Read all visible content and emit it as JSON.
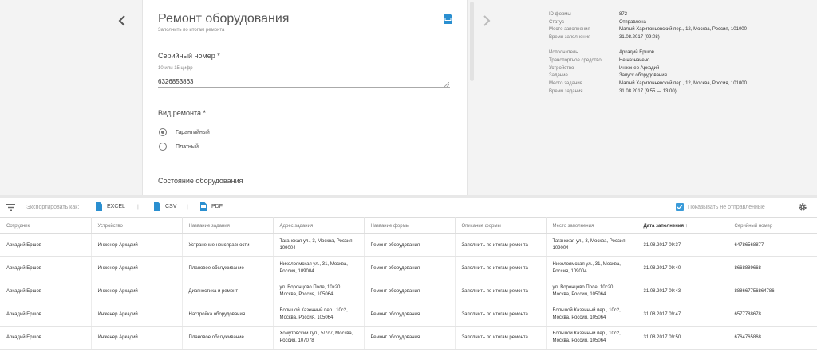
{
  "form": {
    "title": "Ремонт оборудования",
    "subtitle": "Заполнить по итогам ремонта",
    "serial_label": "Серийный номер *",
    "serial_hint": "10 или 15 цифр",
    "serial_value": "6326853863",
    "repair_label": "Вид ремонта *",
    "repair_options": [
      {
        "label": "Гарантийный",
        "checked": true
      },
      {
        "label": "Платный",
        "checked": false
      }
    ],
    "state_label": "Состояние оборудования"
  },
  "info": [
    {
      "key": "ID формы",
      "value": "872"
    },
    {
      "key": "Статус",
      "value": "Отправлена"
    },
    {
      "key": "Место заполнения",
      "value": "Малый Харитоньевский пер., 12, Москва, Россия, 101000"
    },
    {
      "key": "Время заполнения",
      "value": "31.08.2017 (09:08)"
    },
    {
      "key": "Исполнитель",
      "value": "Аркадий Ершов"
    },
    {
      "key": "Транспортное средство",
      "value": "Не назначено"
    },
    {
      "key": "Устройство",
      "value": "Инженер Аркадий"
    },
    {
      "key": "Задание",
      "value": "Запуск оборудования"
    },
    {
      "key": "Место задания",
      "value": "Малый Харитоньевский пер., 12, Москва, Россия, 101000"
    },
    {
      "key": "Время задания",
      "value": "31.08.2017 (9:55 — 13:00)"
    }
  ],
  "toolbar": {
    "export_label": "Экспортировать как:",
    "excel": "EXCEL",
    "csv": "CSV",
    "pdf": "PDF",
    "sep": "|",
    "show_unsent": "Показывать не отправленные"
  },
  "table": {
    "columns": [
      "Сотрудник",
      "Устройство",
      "Название задания",
      "Адрес задания",
      "Название формы",
      "Описание формы",
      "Место заполнения",
      "Дата заполнения ↑",
      "Серийный номер"
    ],
    "rows": [
      [
        "Аркадий Ершов",
        "Инженер Аркадий",
        "Устранение неисправности",
        "Таганская ул., 3, Москва, Россия, 109004",
        "Ремонт оборудования",
        "Заполнить по итогам ремонта",
        "Таганская ул., 3, Москва, Россия, 109004",
        "31.08.2017 09:37",
        "64786568877"
      ],
      [
        "Аркадий Ершов",
        "Инженер Аркадий",
        "Плановое обслуживание",
        "Николоямская ул., 31, Москва, Россия, 109004",
        "Ремонт оборудования",
        "Заполнить по итогам ремонта",
        "Николоямская ул., 31, Москва, Россия, 109004",
        "31.08.2017 09:40",
        "8668889668"
      ],
      [
        "Аркадий Ершов",
        "Инженер Аркадий",
        "Диагностика и ремонт",
        "ул. Воронцово Поле, 10с20, Москва, Россия, 105064",
        "Ремонт оборудования",
        "Заполнить по итогам ремонта",
        "ул. Воронцово Поле, 10с20, Москва, Россия, 105064",
        "31.08.2017 09:43",
        "888667756864786"
      ],
      [
        "Аркадий Ершов",
        "Инженер Аркадий",
        "Настройка оборудования",
        "Большой Казенный пер., 10с2, Москва, Россия, 105064",
        "Ремонт оборудования",
        "Заполнить по итогам ремонта",
        "Большой Казенный пер., 10с2, Москва, Россия, 105064",
        "31.08.2017 09:47",
        "6577788678"
      ],
      [
        "Аркадий Ершов",
        "Инженер Аркадий",
        "Плановое обслуживание",
        "Хомутовский туп., 5/7с7, Москва, Россия, 107078",
        "Ремонт оборудования",
        "Заполнить по итогам ремонта",
        "Большой Казенный пер., 10с2, Москва, Россия, 105064",
        "31.08.2017 09:50",
        "6764765868"
      ]
    ]
  },
  "colors": {
    "accent": "#3a9bd9",
    "icon_blue": "#2a8fd0"
  }
}
